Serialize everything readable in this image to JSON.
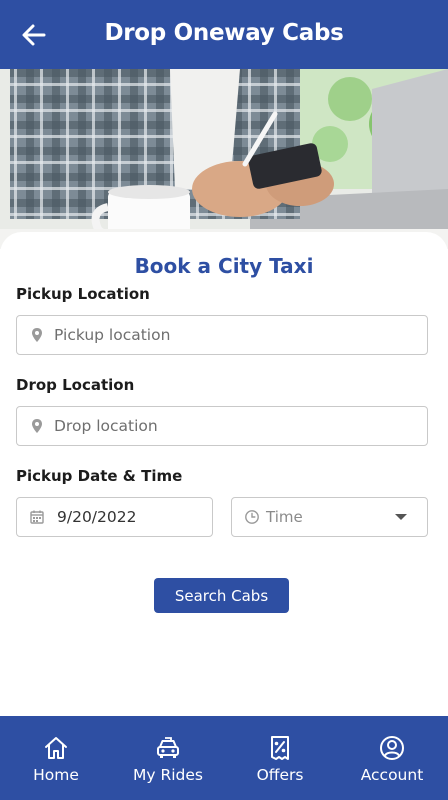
{
  "header": {
    "title": "Drop Oneway Cabs",
    "back_icon": "arrow-left-icon"
  },
  "hero": {
    "description_icon": "hero-photo"
  },
  "form": {
    "title": "Book a City Taxi",
    "pickup": {
      "label": "Pickup Location",
      "placeholder": "Pickup location",
      "value": "",
      "icon": "location-pin-icon"
    },
    "drop": {
      "label": "Drop Location",
      "placeholder": "Drop location",
      "value": "",
      "icon": "location-pin-icon"
    },
    "datetime": {
      "label": "Pickup Date & Time",
      "date_value": "9/20/2022",
      "date_icon": "calendar-icon",
      "time_placeholder": "Time",
      "time_icon": "clock-icon"
    },
    "search_button": "Search Cabs"
  },
  "bottom_nav": [
    {
      "label": "Home",
      "icon": "home-icon"
    },
    {
      "label": "My Rides",
      "icon": "car-icon"
    },
    {
      "label": "Offers",
      "icon": "offer-icon"
    },
    {
      "label": "Account",
      "icon": "account-icon"
    }
  ],
  "colors": {
    "primary": "#2e4fa3",
    "text": "#1c1c1c",
    "border": "#c9c9c9"
  }
}
